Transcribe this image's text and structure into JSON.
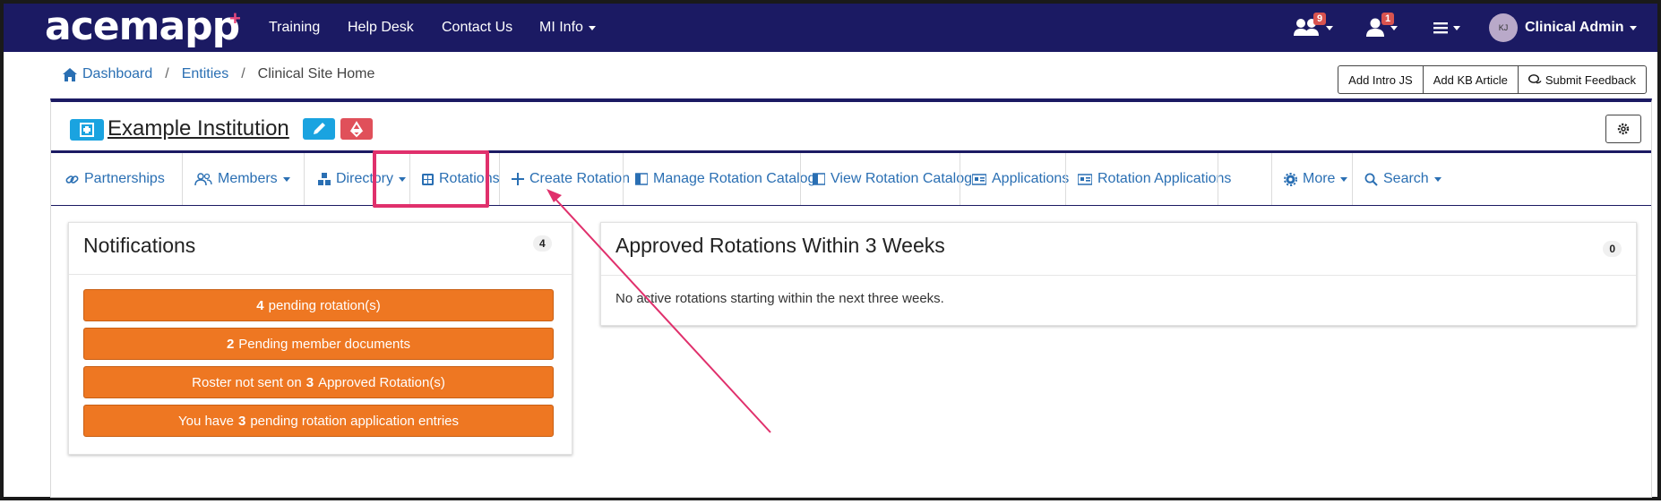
{
  "brand": {
    "logo_text": "acemapp"
  },
  "topnav": {
    "items": [
      {
        "label": "Training"
      },
      {
        "label": "Help Desk"
      },
      {
        "label": "Contact Us"
      },
      {
        "label": "MI Info"
      }
    ],
    "group_badge": "9",
    "user_badge": "1",
    "avatar_initials": "KJ",
    "user_name": "Clinical Admin"
  },
  "breadcrumb": {
    "items": [
      "Dashboard",
      "Entities",
      "Clinical Site Home"
    ],
    "separator": "/"
  },
  "header_buttons": [
    "Add Intro JS",
    "Add KB Article",
    "Submit Feedback"
  ],
  "institution": {
    "name": "Example Institution"
  },
  "tabs": [
    {
      "label": "Partnerships",
      "icon": "link-icon"
    },
    {
      "label": "Members",
      "icon": "users-icon"
    },
    {
      "label": "Directory",
      "icon": "directory-icon"
    },
    {
      "label": "Rotations",
      "icon": "table-icon"
    },
    {
      "label": "Create Rotation",
      "icon": "plus-icon"
    },
    {
      "label": "Manage Rotation Catalog",
      "icon": "book-icon"
    },
    {
      "label": "View Rotation Catalog",
      "icon": "book-icon"
    },
    {
      "label": "Applications",
      "icon": "id-card-icon"
    },
    {
      "label": "Rotation Applications",
      "icon": "id-card-icon"
    },
    {
      "label": "More",
      "icon": "gear-icon"
    },
    {
      "label": "Search",
      "icon": "search-icon"
    }
  ],
  "notifications": {
    "title": "Notifications",
    "count": "4",
    "items": [
      {
        "count": "4",
        "text": "pending rotation(s)"
      },
      {
        "count": "2",
        "text": "Pending member documents"
      },
      {
        "prefix": "Roster not sent on",
        "count": "3",
        "suffix": "Approved Rotation(s)"
      },
      {
        "prefix": "You have",
        "count": "3",
        "suffix": "pending rotation application entries"
      }
    ]
  },
  "approved": {
    "title": "Approved Rotations Within 3 Weeks",
    "count": "0",
    "empty_text": "No active rotations starting within the next three weeks."
  },
  "colors": {
    "navbar": "#1b1a63",
    "link": "#2a6fb3",
    "notification_button": "#ee7722",
    "highlight": "#e0306c"
  }
}
